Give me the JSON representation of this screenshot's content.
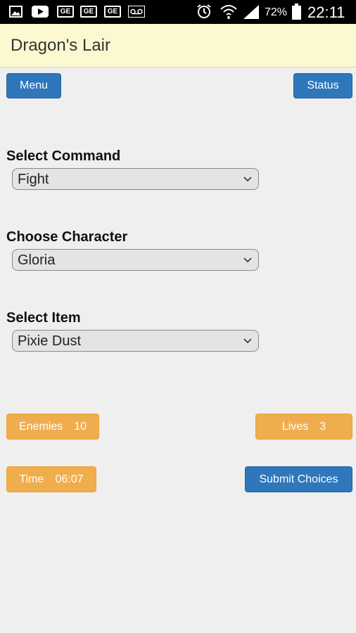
{
  "status_bar": {
    "battery": "72%",
    "time": "22:11",
    "icons": [
      "image-icon",
      "youtube-icon",
      "ge-icon",
      "ge-icon",
      "ge-icon",
      "voicemail-icon",
      "alarm-icon",
      "wifi-icon",
      "signal-icon",
      "battery-icon"
    ],
    "ge_text": "GE"
  },
  "app": {
    "title": "Dragon's Lair"
  },
  "top_buttons": {
    "menu": "Menu",
    "status": "Status"
  },
  "form": {
    "command": {
      "label": "Select Command",
      "value": "Fight"
    },
    "character": {
      "label": "Choose Character",
      "value": "Gloria"
    },
    "item": {
      "label": "Select Item",
      "value": "Pixie Dust"
    }
  },
  "stats": {
    "enemies_label": "Enemies",
    "enemies_value": "10",
    "lives_label": "Lives",
    "lives_value": "3",
    "time_label": "Time",
    "time_value": "06:07"
  },
  "actions": {
    "submit": "Submit Choices"
  },
  "colors": {
    "primary": "#2f77bb",
    "warning": "#f0ad4e",
    "appbar": "#fcf8cf",
    "background": "#efefef"
  }
}
